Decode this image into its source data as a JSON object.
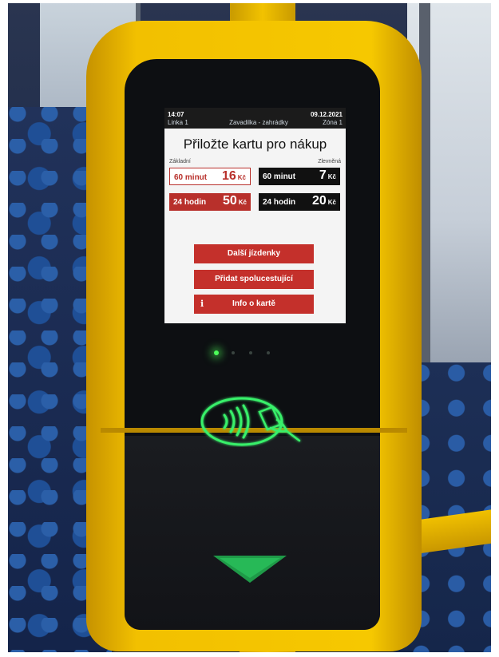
{
  "screen": {
    "status": {
      "time": "14:07",
      "line": "Linka 1",
      "stop": "Zavadilka - zahrádky",
      "date": "09.12.2021",
      "zone": "Zóna 1"
    },
    "prompt": "Přiložte kartu pro nákup",
    "categories": {
      "basic": "Základní",
      "reduced": "Zlevněná"
    },
    "tickets": [
      {
        "duration": "60 minut",
        "amount": "16",
        "currency": "Kč"
      },
      {
        "duration": "60 minut",
        "amount": "7",
        "currency": "Kč"
      },
      {
        "duration": "24 hodin",
        "amount": "50",
        "currency": "Kč"
      },
      {
        "duration": "24 hodin",
        "amount": "20",
        "currency": "Kč"
      }
    ],
    "buttons": {
      "more": "Další jízdenky",
      "companion": "Přidat spolucestující",
      "info": "Info o kartě",
      "info_icon": "i"
    }
  },
  "colors": {
    "accent_red": "#c4302b",
    "housing_yellow": "#f2c000",
    "led_green": "#4cff5a"
  },
  "icons": [
    "contactless-card-icon",
    "down-arrow-icon",
    "info-icon"
  ],
  "indicators": {
    "active_led": 1,
    "total_leds": 4
  }
}
